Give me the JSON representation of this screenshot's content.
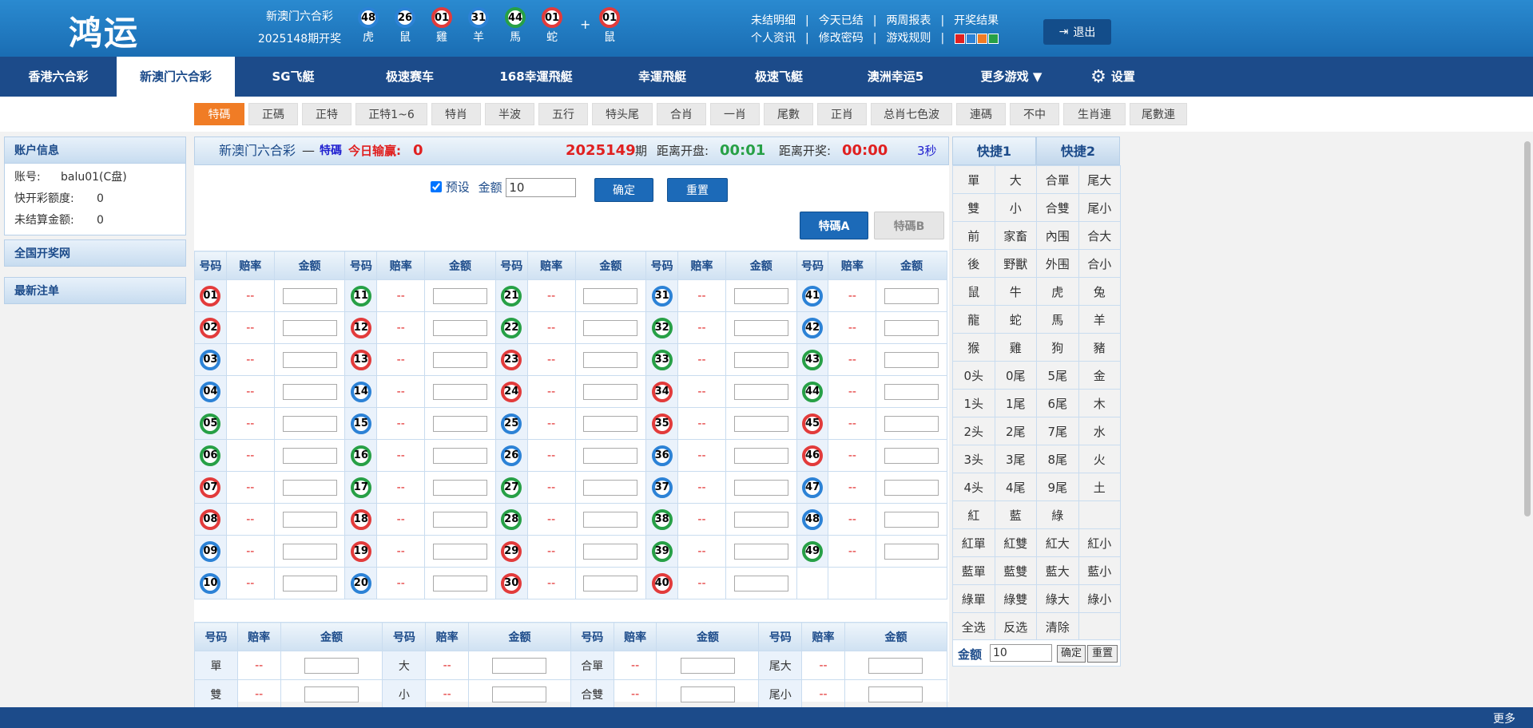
{
  "header": {
    "logo": "鸿运",
    "lottery_name": "新澳门六合彩",
    "period": "2025148期开奖",
    "balls": [
      {
        "num": "48",
        "zodiac": "虎",
        "color": "blue"
      },
      {
        "num": "26",
        "zodiac": "鼠",
        "color": "blue"
      },
      {
        "num": "01",
        "zodiac": "雞",
        "color": "red"
      },
      {
        "num": "31",
        "zodiac": "羊",
        "color": "blue"
      },
      {
        "num": "44",
        "zodiac": "馬",
        "color": "green"
      },
      {
        "num": "01",
        "zodiac": "蛇",
        "color": "red"
      }
    ],
    "special_ball": {
      "num": "01",
      "zodiac": "鼠",
      "color": "red"
    },
    "plus": "+",
    "links_row1": [
      "未结明细",
      "今天已结",
      "两周报表",
      "开奖结果"
    ],
    "links_row2": [
      "个人资讯",
      "修改密码",
      "游戏规则"
    ],
    "theme_colors": [
      "#e02020",
      "#2c82d6",
      "#f07c25",
      "#27a046"
    ],
    "logout": "退出"
  },
  "nav": [
    "香港六合彩",
    "新澳门六合彩",
    "SG飞艇",
    "极速赛车",
    "168幸運飛艇",
    "幸運飛艇",
    "极速飞艇",
    "澳洲幸运5",
    "更多游戏 ▼",
    "设置"
  ],
  "subnav": [
    "特碼",
    "正碼",
    "正特",
    "正特1~6",
    "特肖",
    "半波",
    "五行",
    "特头尾",
    "合肖",
    "一肖",
    "尾數",
    "正肖",
    "总肖七色波",
    "連碼",
    "不中",
    "生肖連",
    "尾數連"
  ],
  "sidebar": {
    "account_title": "账户信息",
    "rows": [
      {
        "label": "账号:",
        "value": "balu01(C盘)"
      },
      {
        "label": "快开彩额度:",
        "value": "0"
      },
      {
        "label": "未结算金额:",
        "value": "0"
      }
    ],
    "national": "全国开奖网",
    "latest": "最新注单"
  },
  "main": {
    "title": "新澳门六合彩",
    "dash": "—",
    "play": "特碼",
    "pl_label": "今日输赢:",
    "pl_value": "0",
    "period": "2025149",
    "period_suffix": "期",
    "open_label": "距离开盘:",
    "open_time": "00:01",
    "draw_label": "距离开奖:",
    "draw_time": "00:00",
    "refresh": "3秒",
    "preset_label": "预设",
    "amount_label": "金额",
    "amount_value": "10",
    "confirm": "确定",
    "reset": "重置",
    "tab_a": "特碼A",
    "tab_b": "特碼B",
    "col_headers": [
      "号码",
      "赔率",
      "金额"
    ],
    "odds_placeholder": "--",
    "numbers": [
      [
        "01",
        "red"
      ],
      [
        "02",
        "red"
      ],
      [
        "03",
        "blue"
      ],
      [
        "04",
        "blue"
      ],
      [
        "05",
        "green"
      ],
      [
        "06",
        "green"
      ],
      [
        "07",
        "red"
      ],
      [
        "08",
        "red"
      ],
      [
        "09",
        "blue"
      ],
      [
        "10",
        "blue"
      ],
      [
        "11",
        "green"
      ],
      [
        "12",
        "red"
      ],
      [
        "13",
        "red"
      ],
      [
        "14",
        "blue"
      ],
      [
        "15",
        "blue"
      ],
      [
        "16",
        "green"
      ],
      [
        "17",
        "green"
      ],
      [
        "18",
        "red"
      ],
      [
        "19",
        "red"
      ],
      [
        "20",
        "blue"
      ],
      [
        "21",
        "green"
      ],
      [
        "22",
        "green"
      ],
      [
        "23",
        "red"
      ],
      [
        "24",
        "red"
      ],
      [
        "25",
        "blue"
      ],
      [
        "26",
        "blue"
      ],
      [
        "27",
        "green"
      ],
      [
        "28",
        "green"
      ],
      [
        "29",
        "red"
      ],
      [
        "30",
        "red"
      ],
      [
        "31",
        "blue"
      ],
      [
        "32",
        "green"
      ],
      [
        "33",
        "green"
      ],
      [
        "34",
        "red"
      ],
      [
        "35",
        "red"
      ],
      [
        "36",
        "blue"
      ],
      [
        "37",
        "blue"
      ],
      [
        "38",
        "green"
      ],
      [
        "39",
        "green"
      ],
      [
        "40",
        "red"
      ],
      [
        "41",
        "blue"
      ],
      [
        "42",
        "blue"
      ],
      [
        "43",
        "green"
      ],
      [
        "44",
        "green"
      ],
      [
        "45",
        "red"
      ],
      [
        "46",
        "red"
      ],
      [
        "47",
        "blue"
      ],
      [
        "48",
        "blue"
      ],
      [
        "49",
        "green"
      ]
    ],
    "extra_rows": [
      [
        "單",
        "大",
        "合單",
        "尾大"
      ],
      [
        "雙",
        "小",
        "合雙",
        "尾小"
      ]
    ]
  },
  "quick": {
    "tab1": "快捷1",
    "tab2": "快捷2",
    "rows": [
      [
        "單",
        "大",
        "合單",
        "尾大"
      ],
      [
        "雙",
        "小",
        "合雙",
        "尾小"
      ],
      [
        "前",
        "家畜",
        "內围",
        "合大"
      ],
      [
        "後",
        "野獸",
        "外围",
        "合小"
      ],
      [
        "鼠",
        "牛",
        "虎",
        "兔"
      ],
      [
        "龍",
        "蛇",
        "馬",
        "羊"
      ],
      [
        "猴",
        "雞",
        "狗",
        "豬"
      ],
      [
        "0头",
        "0尾",
        "5尾",
        "金"
      ],
      [
        "1头",
        "1尾",
        "6尾",
        "木"
      ],
      [
        "2头",
        "2尾",
        "7尾",
        "水"
      ],
      [
        "3头",
        "3尾",
        "8尾",
        "火"
      ],
      [
        "4头",
        "4尾",
        "9尾",
        "土"
      ],
      [
        "紅",
        "藍",
        "綠",
        ""
      ],
      [
        "紅單",
        "紅雙",
        "紅大",
        "紅小"
      ],
      [
        "藍單",
        "藍雙",
        "藍大",
        "藍小"
      ],
      [
        "綠單",
        "綠雙",
        "綠大",
        "綠小"
      ],
      [
        "全选",
        "反选",
        "清除",
        ""
      ]
    ],
    "amount_label": "金额",
    "amount_value": "10",
    "confirm": "确定",
    "reset": "重置"
  },
  "footer": {
    "more": "更多"
  }
}
